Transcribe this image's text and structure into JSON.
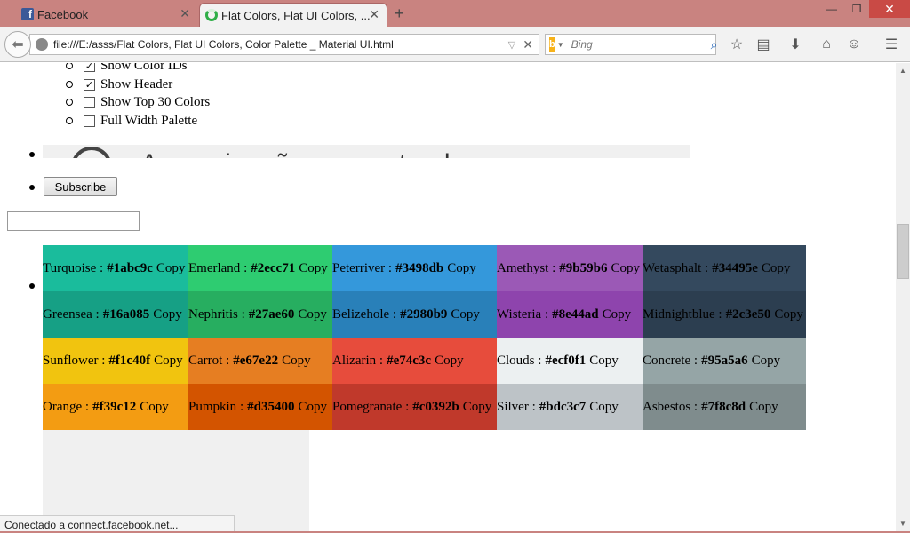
{
  "browser": {
    "tabs": [
      {
        "label": "Facebook",
        "active": false
      },
      {
        "label": "Flat Colors, Flat UI Colors, ...",
        "active": true
      }
    ],
    "new_tab": "+",
    "window_controls": {
      "minimize": "—",
      "restore": "❐",
      "close": "✕"
    },
    "url": "file:///E:/asss/Flat Colors, Flat UI Colors, Color Palette _ Material UI.html",
    "search_engine": "Bing",
    "search_placeholder": "Bing",
    "status": "Conectado a connect.facebook.net..."
  },
  "options": [
    {
      "label": "Show Color IDs",
      "checked": true
    },
    {
      "label": "Show Header",
      "checked": true
    },
    {
      "label": "Show Top 30 Colors",
      "checked": false
    },
    {
      "label": "Full Width Palette",
      "checked": false
    }
  ],
  "ad_text": "Anuncio não encontrado",
  "subscribe_label": "Subscribe",
  "copy_label": "Copy",
  "palette": [
    [
      {
        "name": "Turquoise",
        "hex": "#1abc9c"
      },
      {
        "name": "Emerland",
        "hex": "#2ecc71"
      },
      {
        "name": "Peterriver",
        "hex": "#3498db"
      },
      {
        "name": "Amethyst",
        "hex": "#9b59b6"
      },
      {
        "name": "Wetasphalt",
        "hex": "#34495e"
      }
    ],
    [
      {
        "name": "Greensea",
        "hex": "#16a085"
      },
      {
        "name": "Nephritis",
        "hex": "#27ae60"
      },
      {
        "name": "Belizehole",
        "hex": "#2980b9"
      },
      {
        "name": "Wisteria",
        "hex": "#8e44ad"
      },
      {
        "name": "Midnightblue",
        "hex": "#2c3e50"
      }
    ],
    [
      {
        "name": "Sunflower",
        "hex": "#f1c40f"
      },
      {
        "name": "Carrot",
        "hex": "#e67e22"
      },
      {
        "name": "Alizarin",
        "hex": "#e74c3c"
      },
      {
        "name": "Clouds",
        "hex": "#ecf0f1"
      },
      {
        "name": "Concrete",
        "hex": "#95a5a6"
      }
    ],
    [
      {
        "name": "Orange",
        "hex": "#f39c12"
      },
      {
        "name": "Pumpkin",
        "hex": "#d35400"
      },
      {
        "name": "Pomegranate",
        "hex": "#c0392b"
      },
      {
        "name": "Silver",
        "hex": "#bdc3c7"
      },
      {
        "name": "Asbestos",
        "hex": "#7f8c8d"
      }
    ]
  ],
  "colors": {
    "titlebar": "#c98380",
    "accent_close": "#c94a45"
  }
}
